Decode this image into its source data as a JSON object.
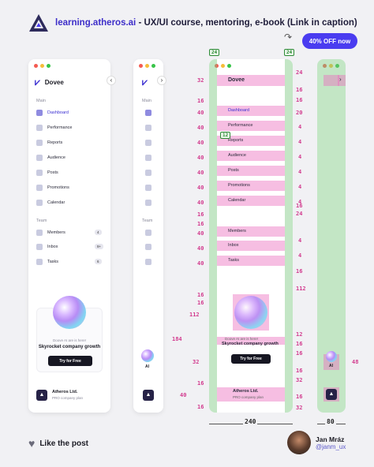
{
  "header": {
    "site": "learning.atheros.ai",
    "tagline": " - UX/UI course, mentoring, e-book (Link in caption)",
    "badge": "40% OFF now"
  },
  "sidebar_full": {
    "brand": "Dovee",
    "collapse_icon": "‹",
    "main_label": "Main",
    "main_items": [
      {
        "label": "Dashboard",
        "icon": "dashboard-icon",
        "active": true
      },
      {
        "label": "Performance",
        "icon": "performance-icon"
      },
      {
        "label": "Reports",
        "icon": "reports-icon"
      },
      {
        "label": "Audience",
        "icon": "audience-icon"
      },
      {
        "label": "Posts",
        "icon": "posts-icon"
      },
      {
        "label": "Promotions",
        "icon": "promotions-icon"
      },
      {
        "label": "Calendar",
        "icon": "calendar-icon"
      }
    ],
    "team_label": "Team",
    "team_items": [
      {
        "label": "Members",
        "icon": "members-icon",
        "badge": "4"
      },
      {
        "label": "Inbox",
        "icon": "inbox-icon",
        "badge": "9+"
      },
      {
        "label": "Tasks",
        "icon": "tasks-icon",
        "badge": "6"
      }
    ],
    "promo": {
      "subtitle": "Doove AI are is here!",
      "title": "Skyrocket company growth",
      "button": "Try for Free"
    },
    "footer": {
      "company": "Atheros Ltd.",
      "plan": "PRO company plan"
    }
  },
  "sidebar_collapsed": {
    "expand_icon": "›",
    "main_label": "Main",
    "team_label": "Team",
    "ai_label": "AI"
  },
  "spec": {
    "top_widths": [
      "24",
      "24"
    ],
    "left_measures": [
      "32",
      "16",
      "40",
      "40",
      "40",
      "40",
      "40",
      "40",
      "40",
      "16",
      "16",
      "40",
      "40",
      "40",
      "16",
      "16",
      "112",
      "184",
      "32",
      "16",
      "40",
      "16"
    ],
    "right_measures": [
      "24",
      "16",
      "16",
      "20",
      "4",
      "4",
      "4",
      "4",
      "4",
      "4",
      "16",
      "24",
      "4",
      "4",
      "16",
      "112",
      "12",
      "16",
      "16",
      "16",
      "32",
      "16",
      "32"
    ],
    "tooltip": "12",
    "width_total": "240",
    "collapsed_width": "80",
    "collapsed_measure": "48"
  },
  "footer": {
    "like": "Like the post",
    "author_name": "Jan Mráz",
    "author_handle": "@janm_ux"
  }
}
